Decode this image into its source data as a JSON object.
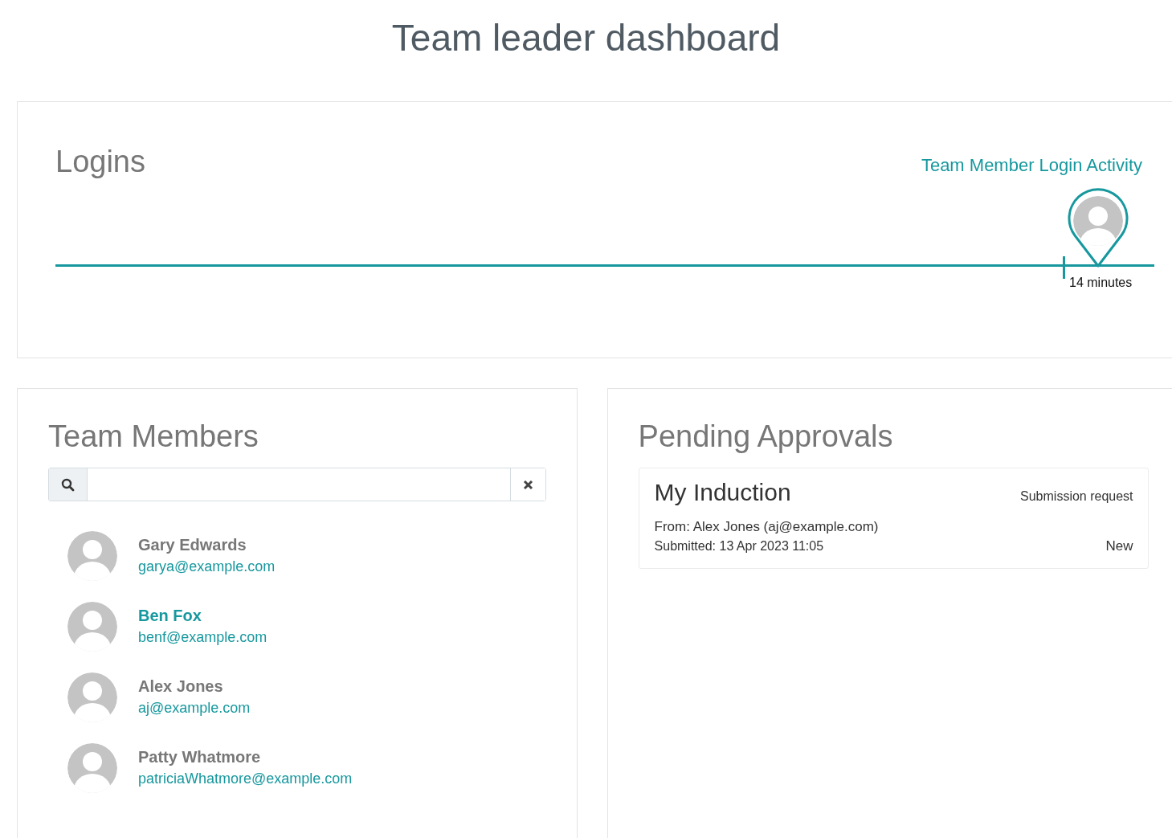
{
  "page": {
    "title": "Team leader dashboard"
  },
  "logins": {
    "title": "Logins",
    "link": "Team Member Login Activity",
    "marker_label": "14 minutes"
  },
  "team_members": {
    "title": "Team Members",
    "members": [
      {
        "name": "Gary Edwards",
        "email": "garya@example.com",
        "selected": false
      },
      {
        "name": "Ben Fox",
        "email": "benf@example.com",
        "selected": true
      },
      {
        "name": "Alex Jones",
        "email": "aj@example.com",
        "selected": false
      },
      {
        "name": "Patty Whatmore",
        "email": "patriciaWhatmore@example.com",
        "selected": false
      }
    ]
  },
  "pending_approvals": {
    "title": "Pending Approvals",
    "items": [
      {
        "title": "My Induction",
        "type": "Submission request",
        "from": "From: Alex Jones (aj@example.com)",
        "submitted": "Submitted: 13 Apr 2023 11:05",
        "status": "New"
      }
    ]
  }
}
